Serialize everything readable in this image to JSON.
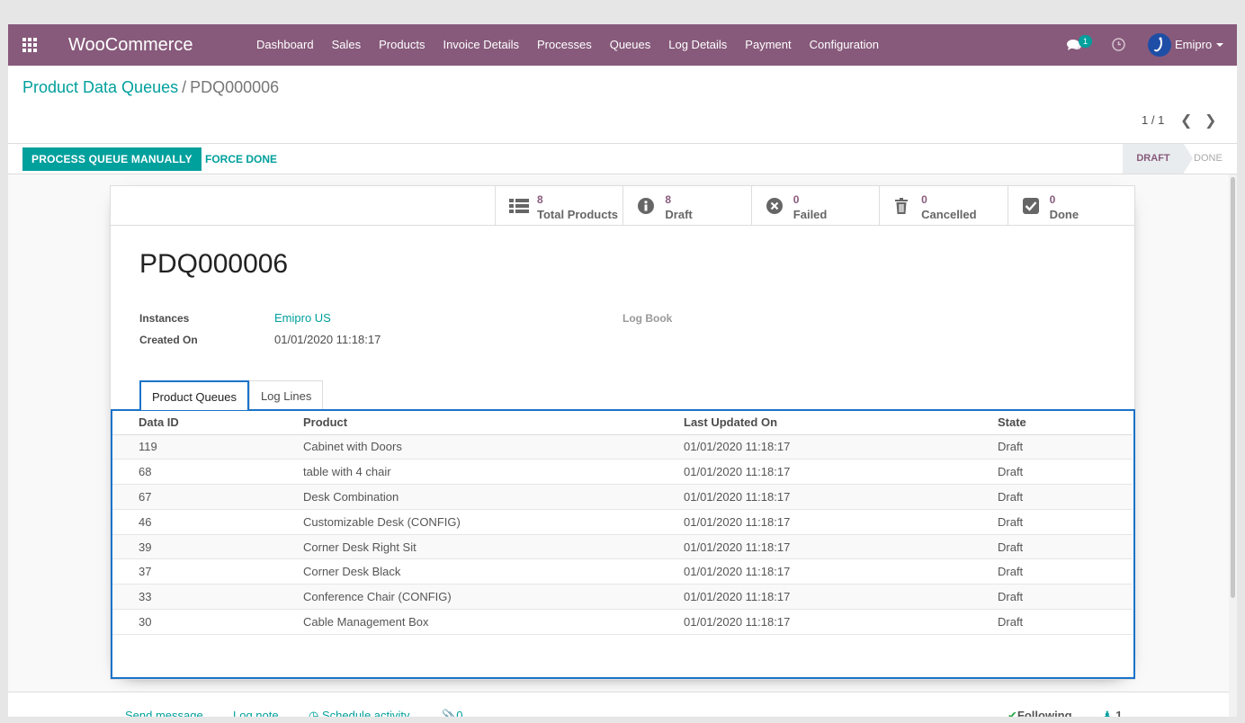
{
  "app": {
    "brand": "WooCommerce",
    "accent_color": "#00a09d",
    "navbar_color": "#875a7b"
  },
  "navbar": {
    "menu": [
      "Dashboard",
      "Sales",
      "Products",
      "Invoice Details",
      "Processes",
      "Queues",
      "Log Details",
      "Payment",
      "Configuration"
    ],
    "chat_badge": "1",
    "user": "Emipro"
  },
  "breadcrumb": {
    "parent": "Product Data Queues",
    "separator": "/",
    "current": "PDQ000006"
  },
  "pager": {
    "text": "1 / 1"
  },
  "statusbar": {
    "process_label": "PROCESS QUEUE MANUALLY",
    "force_done_label": "FORCE DONE",
    "stages": [
      "DRAFT",
      "DONE"
    ],
    "active_stage": "DRAFT"
  },
  "stats": [
    {
      "value": "8",
      "label": "Total Products",
      "icon": "list-icon"
    },
    {
      "value": "8",
      "label": "Draft",
      "icon": "info-icon"
    },
    {
      "value": "0",
      "label": "Failed",
      "icon": "times-circle-icon"
    },
    {
      "value": "0",
      "label": "Cancelled",
      "icon": "trash-icon"
    },
    {
      "value": "0",
      "label": "Done",
      "icon": "check-square-icon"
    }
  ],
  "record": {
    "name": "PDQ000006",
    "instances_label": "Instances",
    "instances_value": "Emipro US",
    "created_on_label": "Created On",
    "created_on_value": "01/01/2020 11:18:17",
    "log_book_label": "Log Book"
  },
  "tabs": [
    "Product Queues",
    "Log Lines"
  ],
  "table": {
    "headers": [
      "Data ID",
      "Product",
      "Last Updated On",
      "State"
    ],
    "rows": [
      [
        "119",
        "Cabinet with Doors",
        "01/01/2020 11:18:17",
        "Draft"
      ],
      [
        "68",
        "table with 4 chair",
        "01/01/2020 11:18:17",
        "Draft"
      ],
      [
        "67",
        "Desk Combination",
        "01/01/2020 11:18:17",
        "Draft"
      ],
      [
        "46",
        "Customizable Desk (CONFIG)",
        "01/01/2020 11:18:17",
        "Draft"
      ],
      [
        "39",
        "Corner Desk Right Sit",
        "01/01/2020 11:18:17",
        "Draft"
      ],
      [
        "37",
        "Corner Desk Black",
        "01/01/2020 11:18:17",
        "Draft"
      ],
      [
        "33",
        "Conference Chair (CONFIG)",
        "01/01/2020 11:18:17",
        "Draft"
      ],
      [
        "30",
        "Cable Management Box",
        "01/01/2020 11:18:17",
        "Draft"
      ]
    ]
  },
  "chatter": {
    "send_message": "Send message",
    "log_note": "Log note",
    "schedule_activity": "Schedule activity",
    "attachments": "0",
    "following": "Following",
    "followers": "1"
  }
}
